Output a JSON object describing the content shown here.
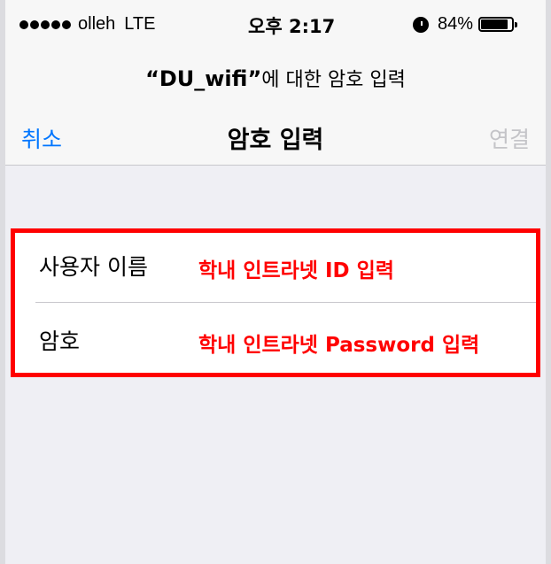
{
  "status_bar": {
    "carrier": "olleh",
    "network": "LTE",
    "time": "오후 2:17",
    "battery_percent": "84%",
    "icons": [
      "signal-dots-icon",
      "alarm-icon",
      "battery-icon"
    ]
  },
  "prompt": {
    "ssid": "“DU_wifi”",
    "suffix": "에 대한 암호 입력"
  },
  "nav": {
    "cancel": "취소",
    "title": "암호 입력",
    "connect": "연결"
  },
  "form": {
    "username_label": "사용자 이름",
    "password_label": "암호",
    "username_value": "",
    "password_value": ""
  },
  "annotations": {
    "username_note": "학내 인트라넷 ID 입력",
    "password_note": "학내 인트라넷 Password 입력",
    "color": "#ff0000"
  },
  "colors": {
    "accent": "#0076ff",
    "disabled": "#c4c4c8",
    "background": "#efeff4"
  }
}
